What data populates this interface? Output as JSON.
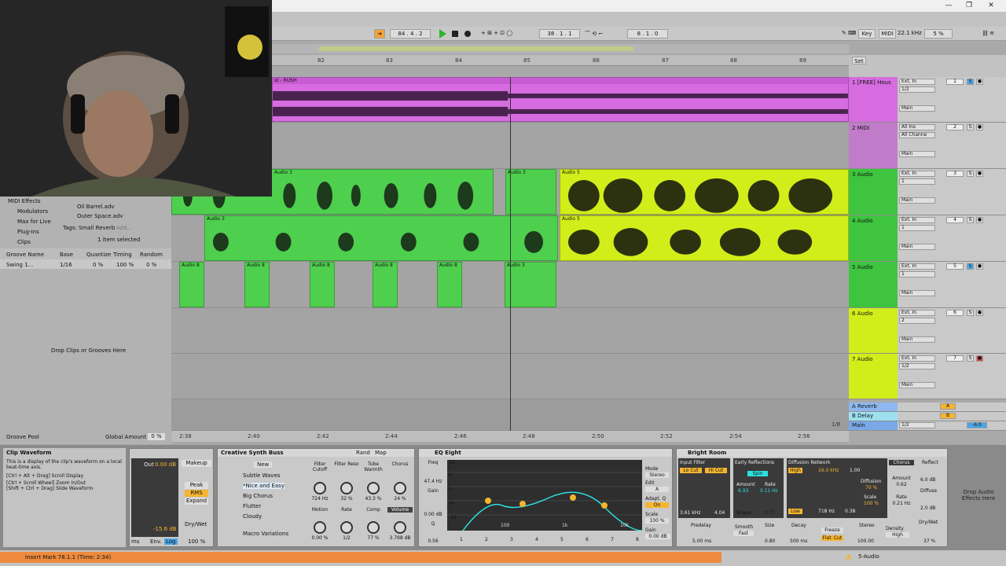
{
  "transport": {
    "position": "84 . 4 . 2",
    "loop_start": "38 . 1 . 1",
    "loop_length": "8 . 1 . 0",
    "key_label": "Key",
    "midi_label": "MIDI",
    "sample_rate": "22.1 kHz",
    "cpu": "5 %"
  },
  "ruler": {
    "bars": [
      "82",
      "83",
      "84",
      "85",
      "86",
      "87",
      "88",
      "89"
    ],
    "set_label": "Set"
  },
  "time_ruler": {
    "times": [
      "2:38",
      "2:40",
      "2:42",
      "2:44",
      "2:46",
      "2:48",
      "2:50",
      "2:52",
      "2:54",
      "2:56"
    ],
    "zoom": "1/8"
  },
  "tracks": [
    {
      "name": "1 [FREE] Hous",
      "input": "Ext. In",
      "chan": "1/2",
      "num": "1",
      "route": "Main",
      "color": "#d66ce0",
      "clip": "st - RUSH"
    },
    {
      "name": "2 MIDI",
      "input": "All Ins",
      "chan": "All Channe",
      "num": "2",
      "route": "Main",
      "color": "#c07cc8"
    },
    {
      "name": "3 Audio",
      "input": "Ext. In",
      "chan": "1",
      "num": "3",
      "route": "Main",
      "color": "#3ec43e"
    },
    {
      "name": "4 Audio",
      "input": "Ext. In",
      "chan": "1",
      "num": "4",
      "route": "Main",
      "color": "#3ec43e"
    },
    {
      "name": "5 Audio",
      "input": "Ext. In",
      "chan": "1",
      "num": "5",
      "route": "Main",
      "color": "#3ec43e"
    },
    {
      "name": "6 Audio",
      "input": "Ext. In",
      "chan": "2",
      "num": "6",
      "route": "Main",
      "color": "#d2ee1a"
    },
    {
      "name": "7 Audio",
      "input": "Ext. In",
      "chan": "1/2",
      "num": "7",
      "route": "Main",
      "color": "#d2ee1a"
    }
  ],
  "returns": [
    {
      "name": "A Reverb",
      "letter": "A"
    },
    {
      "name": "B Delay",
      "letter": "B"
    },
    {
      "name": "Main",
      "chan": "1/2",
      "vol": "-6.0"
    }
  ],
  "clip_labels": {
    "audio3": "Audio 3",
    "audio5": "Audio 5",
    "audio8": "Audio 8"
  },
  "browser": {
    "items": [
      "MIDI Effects",
      "Modulators",
      "Max for Live",
      "Plug-Ins",
      "Clips"
    ],
    "files": [
      "Oil Barrel.adv",
      "Outer Space.adv"
    ],
    "tags_label": "Tags:",
    "tag": "Small Reverb",
    "add": "Add...",
    "selected": "1 item selected",
    "groove_headers": [
      "Groove Name",
      "Base",
      "Quantize",
      "Timing",
      "Random"
    ],
    "groove_row": [
      "Swing 1...",
      "1/16",
      "0 %",
      "100 %",
      "0 %"
    ],
    "drop_hint": "Drop Clips or Grooves Here",
    "groove_pool": "Groove Pool",
    "global_amount_label": "Global Amount",
    "global_amount": "0 %"
  },
  "info": {
    "title": "Clip Waveform",
    "text": "This is a display of the clip's waveform on a local beat-time axis.",
    "shortcuts": [
      "[Ctrl + Alt + Drag] Scroll Display",
      "[Ctrl + Scroll Wheel] Zoom In/Out",
      "[Shift + Ctrl + Drag] Slide Waveform"
    ]
  },
  "comp": {
    "out_label": "Out",
    "out": "0.00 dB",
    "makeup": "Makeup",
    "peak": "Peak",
    "rms": "RMS",
    "expand": "Expand",
    "gr": "-15.6 dB",
    "drywet_label": "Dry/Wet",
    "drywet": "100 %",
    "ms": "ms",
    "env": "Env.",
    "log": "Log"
  },
  "synth": {
    "title": "Creative Synth Buss",
    "rand": "Rand",
    "map": "Map",
    "new": "New",
    "presets": [
      "Subtle Waves",
      "*Nice and Easy",
      "Big Chorus",
      "Flutter",
      "Cloudy"
    ],
    "macro_label": "Macro Variations",
    "macros": [
      {
        "name": "Filter Cutoff",
        "value": "724 Hz"
      },
      {
        "name": "Filter Reso",
        "value": "32 %"
      },
      {
        "name": "Tube Warmth",
        "value": "43.3 %"
      },
      {
        "name": "Chorus",
        "value": "24 %"
      },
      {
        "name": "Motion",
        "value": "0.00 %"
      },
      {
        "name": "Rate",
        "value": "1/2"
      },
      {
        "name": "Comp",
        "value": "77 %"
      },
      {
        "name": "Volume",
        "value": "3.798 dB"
      }
    ]
  },
  "eq": {
    "title": "EQ Eight",
    "freq_label": "Freq",
    "freq": "47.4 Hz",
    "gain_label": "Gain",
    "gain": "0.00 dB",
    "q_label": "Q",
    "q": "0.56",
    "ticks": [
      "12",
      "6",
      "0",
      "-6",
      "-12"
    ],
    "mode_label": "Mode",
    "mode": "Stereo",
    "edit_label": "Edit",
    "edit": "A",
    "adapt_label": "Adapt. Q",
    "adapt": "On",
    "scale_label": "Scale",
    "scale": "100 %",
    "out_gain_label": "Gain",
    "out_gain": "0.00 dB",
    "freq_axis": [
      "100",
      "1k",
      "10k"
    ],
    "bands": [
      "1",
      "2",
      "3",
      "4",
      "5",
      "6",
      "7",
      "8"
    ]
  },
  "reverb": {
    "title": "Bright Room",
    "input_filter": "Input Filter",
    "lo_cut": "Lo Cut",
    "hi_cut": "Hi Cut",
    "lo_freq": "3.61 kHz",
    "hi_freq": "4.04",
    "early": "Early Reflections",
    "spin": "Spin",
    "amount_label": "Amount",
    "amount": "6.93",
    "rate_label": "Rate",
    "rate": "0.11 Hz",
    "shape_label": "Shape",
    "shape": "0.77",
    "diffusion_net": "Diffusion Network",
    "high": "High",
    "high_freq": "16.0 kHz",
    "high_val": "1.00",
    "low": "Low",
    "low_freq": "718 Hz",
    "low_val": "0.38",
    "diffusion_label": "Diffusion",
    "diffusion": "70 %",
    "scale_label": "Scale",
    "scale": "100 %",
    "chorus": "Chorus",
    "ch_amount_label": "Amount",
    "ch_amount": "0.62",
    "ch_rate_label": "Rate",
    "ch_rate": "0.21 Hz",
    "predelay_label": "Predelay",
    "predelay": "5.00 ms",
    "smooth_label": "Smooth",
    "smooth": "Fast",
    "size_label": "Size",
    "size": "0.80",
    "decay_label": "Decay",
    "decay": "500 ms",
    "freeze": "Freeze",
    "flat": "Flat",
    "cut": "Cut",
    "stereo_label": "Stereo",
    "stereo": "100.00",
    "density_label": "Density",
    "density": "High",
    "reflect_label": "Reflect",
    "reflect": "6.0 dB",
    "diffuse_label": "Diffuse",
    "diffuse": "2.0 dB",
    "drywet_label": "Dry/Wet",
    "drywet": "37 %"
  },
  "drop_effects": "Drop Audio Effects Here",
  "status": {
    "message": "Insert Mark 78.1.1 (Time: 2:34)",
    "track": "5-Audio"
  }
}
